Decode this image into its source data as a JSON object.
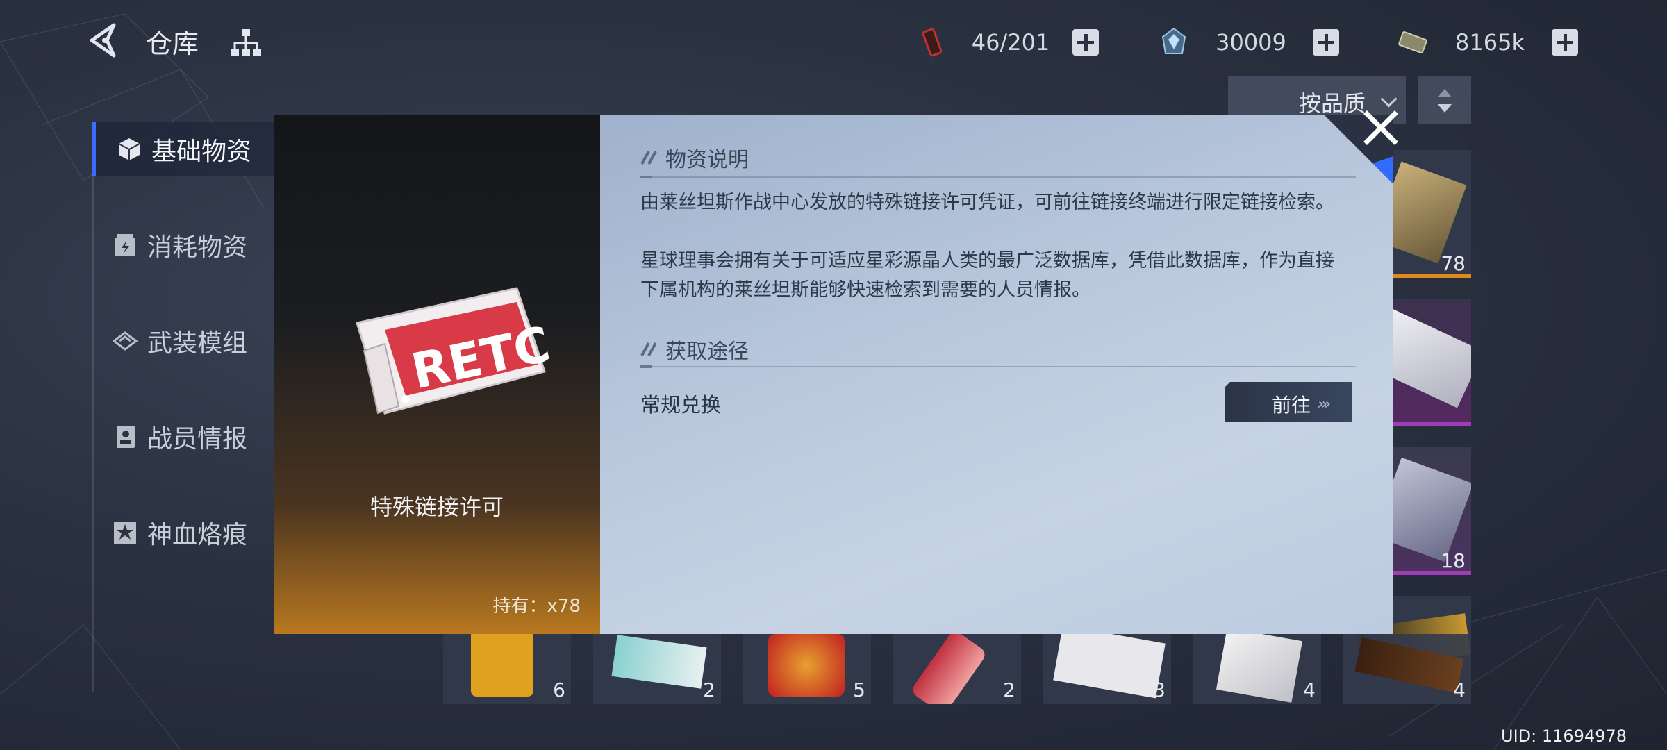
{
  "header": {
    "title": "仓库",
    "resources": [
      {
        "icon": "stamina-battery-icon",
        "value": "46/201"
      },
      {
        "icon": "crystal-currency-icon",
        "value": "30009"
      },
      {
        "icon": "cash-currency-icon",
        "value": "8165k"
      }
    ]
  },
  "sort": {
    "label": "按品质"
  },
  "sidebar": {
    "items": [
      {
        "label": "基础物资",
        "icon": "cube-icon",
        "active": true
      },
      {
        "label": "消耗物资",
        "icon": "box-bolt-icon",
        "active": false
      },
      {
        "label": "武装模组",
        "icon": "module-icon",
        "active": false
      },
      {
        "label": "战员情报",
        "icon": "profile-card-icon",
        "active": false
      },
      {
        "label": "神血烙痕",
        "icon": "star-seal-icon",
        "active": false
      }
    ]
  },
  "grid": {
    "right_column_counts": [
      "78",
      "",
      "18",
      "4"
    ],
    "bottom_row_counts": [
      "6",
      "2",
      "5",
      "2",
      "3",
      "4",
      "4"
    ]
  },
  "modal": {
    "item_name": "特殊链接许可",
    "item_logo_text": "RETC",
    "hold_label": "持有：x78",
    "desc_heading": "物资说明",
    "desc_p1": "由莱丝坦斯作战中心发放的特殊链接许可凭证，可前往链接终端进行限定链接检索。",
    "desc_p2_line1": "星球理事会拥有关于可适应星彩源晶人类的最广泛数据库，凭借此数据库，作为直接",
    "desc_p2_line2": "下属机构的莱丝坦斯能够快速检索到需要的人员情报。",
    "source_heading": "获取途径",
    "route_label": "常规兑换",
    "go_label": "前往"
  },
  "footer": {
    "uid": "UID: 11694978"
  },
  "colors": {
    "accent": "#3a6cff",
    "orange_rarity": "#e08a1e",
    "purple_rarity": "#a03cb8"
  }
}
